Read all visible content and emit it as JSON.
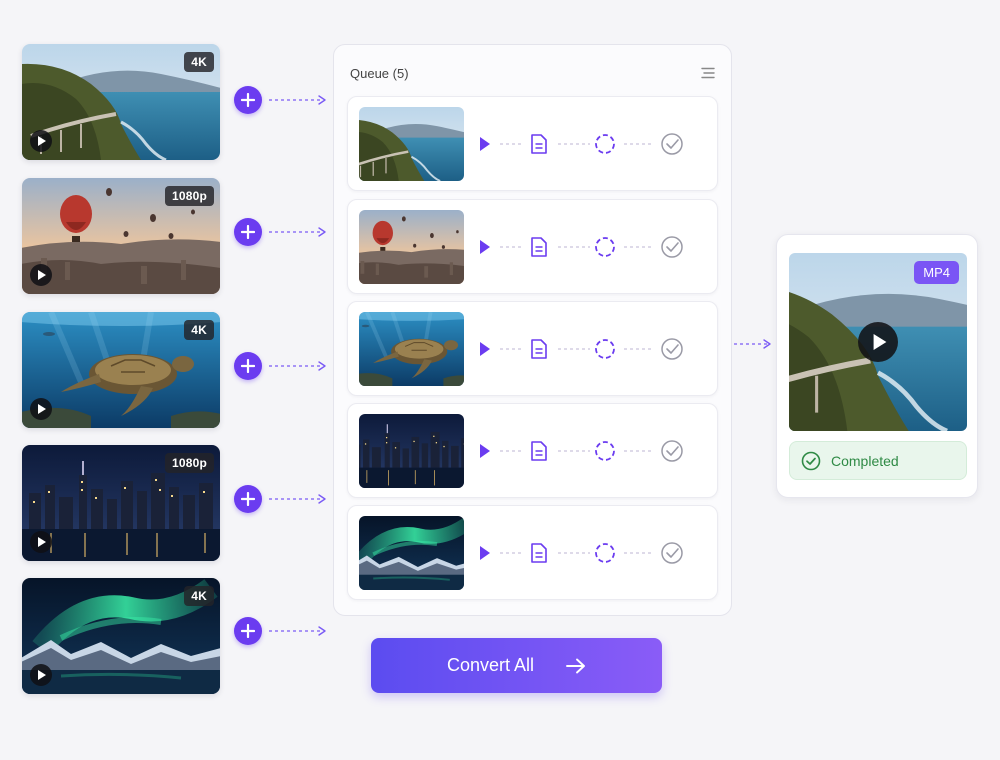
{
  "sources": [
    {
      "resolution": "4K",
      "scene": "coast-icon"
    },
    {
      "resolution": "1080p",
      "scene": "balloon-icon"
    },
    {
      "resolution": "4K",
      "scene": "turtle-icon"
    },
    {
      "resolution": "1080p",
      "scene": "city-icon"
    },
    {
      "resolution": "4K",
      "scene": "aurora-icon"
    }
  ],
  "queue": {
    "title": "Queue (5)",
    "steps": [
      "play-icon",
      "file-icon",
      "convert-icon",
      "check-icon"
    ]
  },
  "output": {
    "format": "MP4",
    "status": "Completed"
  },
  "convert_button": {
    "label": "Convert All"
  },
  "colors": {
    "accent": "#6b3cf0",
    "success": "#2f8a45",
    "success_bg": "#e9f6ec"
  }
}
